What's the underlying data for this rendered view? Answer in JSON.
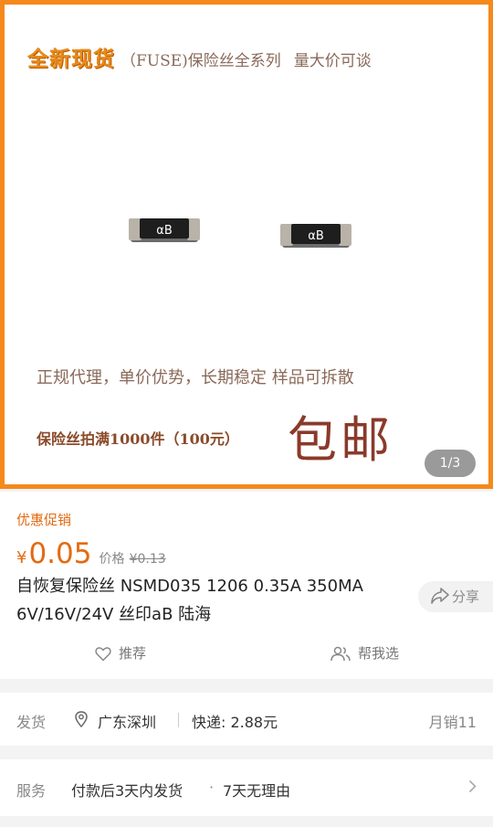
{
  "hero": {
    "headline_bold": "全新现货",
    "headline_rest": "（FUSE)保险丝全系列",
    "headline_right": "量大价可谈",
    "chip_marking": "αB",
    "line1": "正规代理，单价优势，长期稳定 样品可拆散",
    "line2": "保险丝拍满1000件（100元）",
    "big_text": "包邮",
    "page_indicator": "1/3"
  },
  "promo": {
    "label": "优惠促销",
    "currency": "¥",
    "price": "0.05",
    "orig_label": "价格",
    "orig_price": "¥0.13"
  },
  "product": {
    "title": "自恢复保险丝 NSMD035 1206 0.35A 350MA 6V/16V/24V 丝印aB 陆海"
  },
  "actions": {
    "share": "分享",
    "recommend": "推荐",
    "help_choose": "帮我选"
  },
  "shipping": {
    "label": "发货",
    "location": "广东深圳",
    "express": "快递: 2.88元",
    "monthly_sales": "月销11"
  },
  "service": {
    "label": "服务",
    "item1": "付款后3天内发货",
    "separator": "·",
    "item2": "7天无理由"
  },
  "colors": {
    "accent": "#e36a12",
    "hero_border": "#f5891c"
  }
}
